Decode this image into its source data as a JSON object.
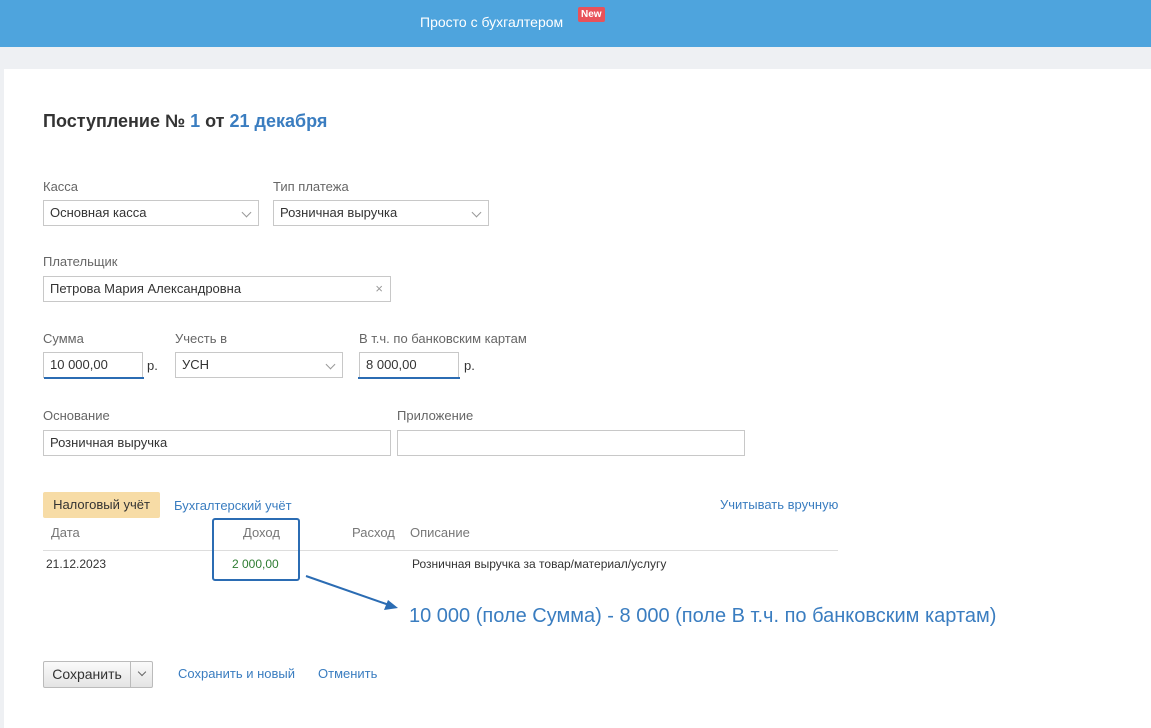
{
  "header": {
    "title": "Просто с бухгалтером",
    "badge": "New"
  },
  "document": {
    "title_prefix": "Поступление №",
    "number": "1",
    "date_prefix": "от",
    "date": "21 декабря"
  },
  "form": {
    "kassa": {
      "label": "Касса",
      "value": "Основная касса"
    },
    "payment_type": {
      "label": "Тип платежа",
      "value": "Розничная выручка"
    },
    "payer": {
      "label": "Плательщик",
      "value": "Петрова Мария Александровна",
      "clear_icon": "×"
    },
    "sum": {
      "label": "Сумма",
      "value": "10 000,00",
      "currency": "р."
    },
    "account_in": {
      "label": "Учесть в",
      "value": "УСН"
    },
    "cards": {
      "label": "В т.ч. по банковским картам",
      "value": "8 000,00",
      "currency": "р."
    },
    "basis": {
      "label": "Основание",
      "value": "Розничная выручка"
    },
    "attachment": {
      "label": "Приложение",
      "value": ""
    }
  },
  "accounting": {
    "tabs": [
      "Налоговый учёт",
      "Бухгалтерский учёт"
    ],
    "manual_link": "Учитывать вручную",
    "columns": [
      "Дата",
      "Доход",
      "Расход",
      "Описание"
    ],
    "rows": [
      {
        "date": "21.12.2023",
        "income": "2 000,00",
        "expense": "",
        "description": "Розничная выручка за товар/материал/услугу"
      }
    ]
  },
  "annotation": {
    "text": "10 000 (поле Сумма) - 8 000 (поле В т.ч. по банковским картам)",
    "color": "#2b6cb3"
  },
  "actions": {
    "save": "Сохранить",
    "save_and_new": "Сохранить и новый",
    "cancel": "Отменить"
  },
  "colors": {
    "header": "#4ea4dd",
    "link": "#3a7dc0",
    "active_tab": "#f7dca6",
    "badge": "#e8525a",
    "income": "#2e7d32"
  }
}
